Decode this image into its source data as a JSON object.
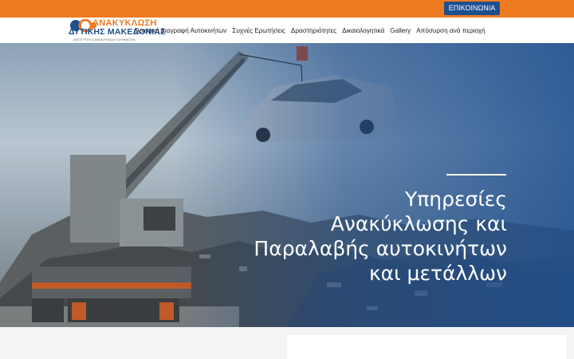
{
  "header": {
    "contact_label": "ΕΠΙΚΟΙΝΩΝΙΑ",
    "logo": {
      "line1": "ΑΝΑΚΥΚΛΩΣΗ",
      "line2": "ΔΥΤΙΚΗΣ ΜΑΚΕΔΟΝΙΑΣ",
      "line3": "ΑΠΟΣΥΡΣΗ & ΑΝΑΚΥΚΛΩΣΗ ΟΧΗΜΑΤΩΝ"
    },
    "nav": [
      {
        "label": "Οριστική Διαγραφή Αυτοκινήτων"
      },
      {
        "label": "Συχνές Ερωτήσεις"
      },
      {
        "label": "Δραστηριότητες"
      },
      {
        "label": "Δικαιολογητικά"
      },
      {
        "label": "Gallery"
      },
      {
        "label": "Απόσυρση ανά περιοχή"
      }
    ]
  },
  "hero": {
    "title_lines": [
      "Υπηρεσίες",
      "Ανακύκλωσης και",
      "Παραλαβής αυτοκινήτων",
      "και μετάλλων"
    ]
  },
  "colors": {
    "brand_orange": "#f07a20",
    "brand_blue": "#1e4f8f"
  }
}
